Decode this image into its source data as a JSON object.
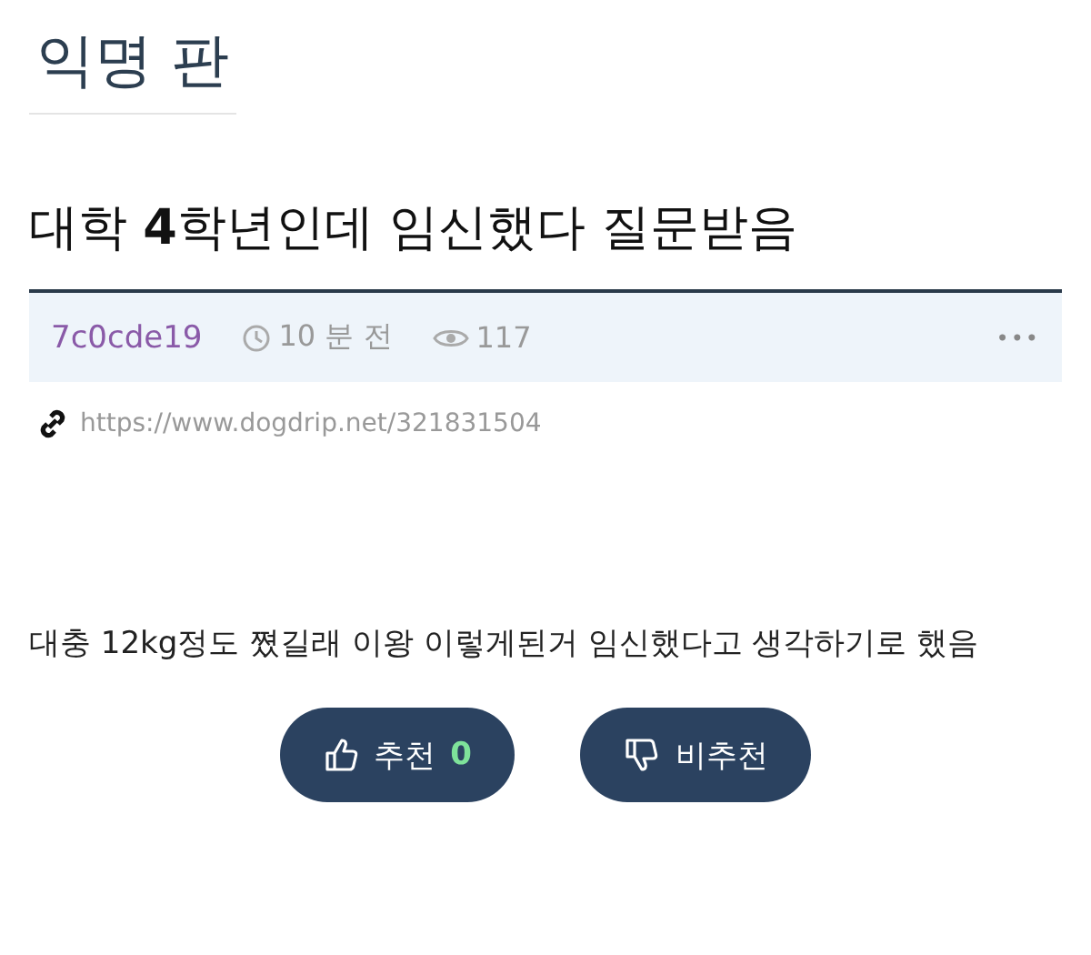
{
  "board": {
    "title": "익명 판"
  },
  "post": {
    "title": "대학 **4**학년인데 임신했다 질문받음",
    "author": "7c0cde19",
    "time": "10 분 전",
    "views": "117",
    "more": "•••",
    "url": "https://www.dogdrip.net/321831504",
    "body": "대충 12kg정도 쪘길래 이왕 이렇게된거 임신했다고 생각하기로 했음"
  },
  "votes": [
    {
      "kind": "up",
      "label": "추천",
      "count": "0"
    },
    {
      "kind": "down",
      "label": "비추천"
    }
  ]
}
